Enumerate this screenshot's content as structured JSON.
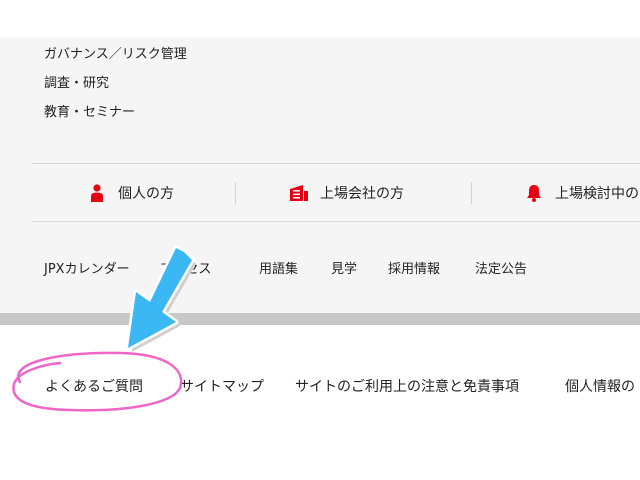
{
  "menu_links": [
    "ガバナンス／リスク管理",
    "調査・研究",
    "教育・セミナー"
  ],
  "audience_links": [
    {
      "label": "個人の方",
      "icon": "person-icon"
    },
    {
      "label": "上場会社の方",
      "icon": "building-icon"
    },
    {
      "label": "上場検討中の",
      "icon": "bell-icon"
    }
  ],
  "utility_links": [
    "JPXカレンダー",
    "アクセス",
    "用語集",
    "見学",
    "採用情報",
    "法定公告"
  ],
  "footer_links": [
    "よくあるご質問",
    "サイトマップ",
    "サイトのご利用上の注意と免責事項",
    "個人情報の"
  ],
  "colors": {
    "brand_red": "#e60012",
    "arrow_blue": "#3bb7f3",
    "circle_pink": "#ee66c8"
  }
}
